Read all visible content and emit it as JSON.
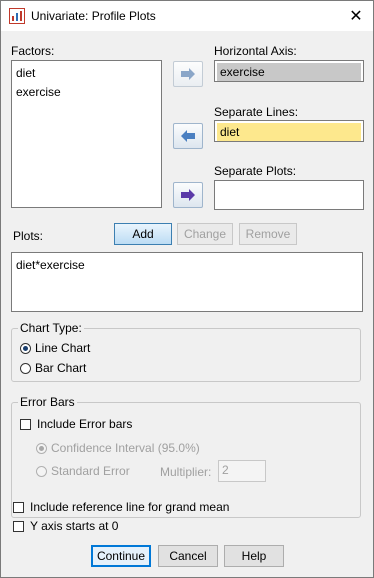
{
  "window": {
    "title": "Univariate: Profile Plots",
    "icon": "bar-chart-app-icon",
    "close_glyph": "✕"
  },
  "factors": {
    "label": "Factors:",
    "items": [
      "diet",
      "exercise"
    ]
  },
  "horizontal_axis": {
    "label": "Horizontal Axis:",
    "value": "exercise"
  },
  "separate_lines": {
    "label": "Separate Lines:",
    "value": "diet"
  },
  "separate_plots": {
    "label": "Separate Plots:",
    "value": ""
  },
  "plots": {
    "label": "Plots:",
    "add_label": "Add",
    "change_label": "Change",
    "remove_label": "Remove",
    "items": [
      "diet*exercise"
    ]
  },
  "chart_type": {
    "title": "Chart Type:",
    "options": [
      "Line Chart",
      "Bar Chart"
    ],
    "selected": "Line Chart"
  },
  "error_bars": {
    "title": "Error Bars",
    "include_label": "Include Error bars",
    "include_checked": false,
    "ci_label": "Confidence Interval (95.0%)",
    "se_label": "Standard Error",
    "multiplier_label": "Multiplier:",
    "multiplier_value": "2"
  },
  "options": {
    "grand_mean_label": "Include reference line for grand mean",
    "y_axis_zero_label": "Y axis starts at 0"
  },
  "footer": {
    "continue_label": "Continue",
    "cancel_label": "Cancel",
    "help_label": "Help"
  },
  "colors": {
    "selected_field": "#c8c8c8",
    "highlighted_field": "#fde88d",
    "arrow_active": "#4a7fc1",
    "arrow_dim": "#8aa6c8",
    "plot_arrow": "#5b3aa8"
  }
}
